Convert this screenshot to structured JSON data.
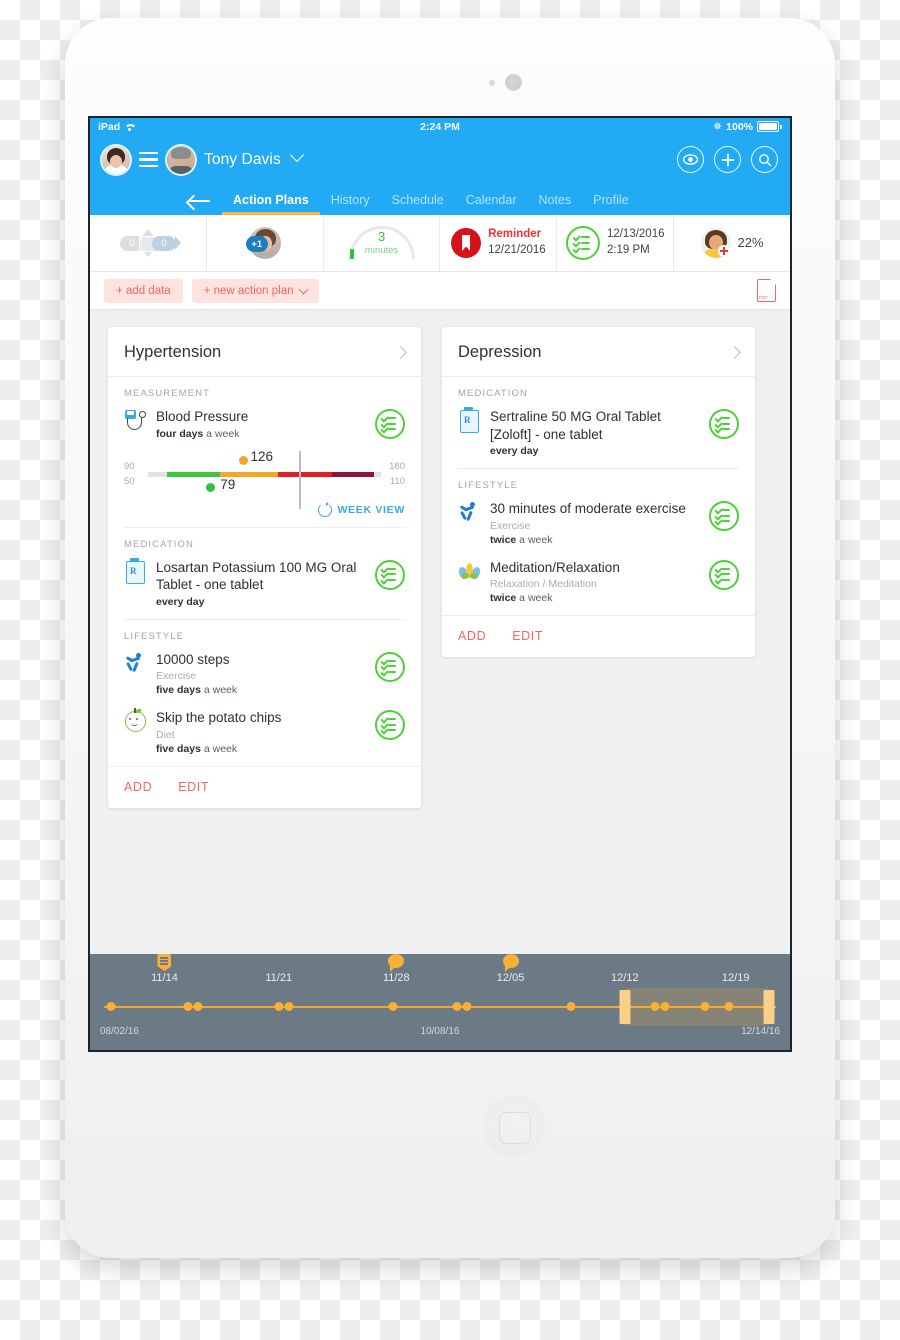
{
  "status_bar": {
    "device": "iPad",
    "wifi_icon": "wifi-icon",
    "time": "2:24 PM",
    "bluetooth_icon": "bluetooth-icon",
    "battery": "100%"
  },
  "topnav": {
    "menu_icon": "hamburger-menu-icon",
    "nurse_avatar": "clinician-avatar",
    "patient_avatar": "patient-avatar",
    "patient_name": "Tony Davis",
    "patient_dropdown_icon": "chevron-down-icon",
    "actions": [
      {
        "name": "eye-icon",
        "label": ""
      },
      {
        "name": "plus-icon",
        "label": ""
      },
      {
        "name": "search-icon",
        "label": ""
      }
    ],
    "back_icon": "back-arrow-icon",
    "tabs": [
      {
        "label": "Action Plans",
        "active": true
      },
      {
        "label": "History",
        "active": false
      },
      {
        "label": "Schedule",
        "active": false
      },
      {
        "label": "Calendar",
        "active": false
      },
      {
        "label": "Notes",
        "active": false
      },
      {
        "label": "Profile",
        "active": false
      }
    ]
  },
  "stats": {
    "messages": {
      "icon": "messages-icon",
      "unread": "0",
      "sent": "0"
    },
    "care_team": {
      "icon": "care-team-avatar",
      "badge": "+1"
    },
    "time_gauge": {
      "icon": "gauge-icon",
      "value": "3",
      "unit": "minutes"
    },
    "reminder": {
      "icon": "bookmark-icon",
      "label": "Reminder",
      "date": "12/21/2016"
    },
    "last_update": {
      "icon": "checklist-icon",
      "date": "12/13/2016",
      "time": "2:19 PM"
    },
    "adherence": {
      "icon": "doctor-avatar",
      "value": "22%"
    }
  },
  "action_row": {
    "add_data": "+ add data",
    "new_action_plan": "+ new action plan",
    "dropdown_icon": "chevron-down-icon",
    "pdf_icon": "pdf-export-icon"
  },
  "cards": [
    {
      "title": "Hypertension",
      "expand_icon": "chevron-right-icon",
      "sections": [
        {
          "label": "MEASUREMENT",
          "items": [
            {
              "icon": "blood-pressure-cuff-icon",
              "title": "Blood Pressure",
              "subtitle": "",
              "freq_bold": "four days",
              "freq_rest": " a week",
              "status_icon": "checklist-green-icon"
            }
          ]
        },
        {
          "label": "MEDICATION",
          "items": [
            {
              "icon": "prescription-bottle-icon",
              "title": "Losartan Potassium 100 MG Oral Tablet - one tablet",
              "subtitle": "",
              "freq_bold": "every day",
              "freq_rest": "",
              "status_icon": "checklist-green-icon"
            }
          ]
        },
        {
          "label": "LIFESTYLE",
          "items": [
            {
              "icon": "running-person-icon",
              "title": "10000 steps",
              "subtitle": "Exercise",
              "freq_bold": "five days",
              "freq_rest": " a week",
              "status_icon": "checklist-green-icon"
            },
            {
              "icon": "apple-diet-icon",
              "title": "Skip the potato chips",
              "subtitle": "Diet",
              "freq_bold": "five days",
              "freq_rest": " a week",
              "status_icon": "checklist-green-icon"
            }
          ]
        }
      ],
      "bp_gauge": {
        "systolic_min": "90",
        "systolic_max": "180",
        "diastolic_min": "50",
        "diastolic_max": "110",
        "systolic_value": "126",
        "diastolic_value": "79",
        "systolic_color": "#f5a623",
        "diastolic_color": "#2ec23f",
        "week_view_label": "WEEK VIEW",
        "week_view_icon": "refresh-icon"
      },
      "footer": {
        "add": "ADD",
        "edit": "EDIT"
      }
    },
    {
      "title": "Depression",
      "expand_icon": "chevron-right-icon",
      "sections": [
        {
          "label": "MEDICATION",
          "items": [
            {
              "icon": "prescription-bottle-icon",
              "title": "Sertraline 50 MG Oral Tablet [Zoloft] - one tablet",
              "subtitle": "",
              "freq_bold": "every day",
              "freq_rest": "",
              "status_icon": "checklist-green-icon"
            }
          ]
        },
        {
          "label": "LIFESTYLE",
          "items": [
            {
              "icon": "running-person-icon",
              "title": "30 minutes of moderate exercise",
              "subtitle": "Exercise",
              "freq_bold": "twice",
              "freq_rest": " a week",
              "status_icon": "checklist-green-icon"
            },
            {
              "icon": "lotus-meditation-icon",
              "title": "Meditation/Relaxation",
              "subtitle": "Relaxation / Meditation",
              "freq_bold": "twice",
              "freq_rest": " a week",
              "status_icon": "checklist-green-icon"
            }
          ]
        }
      ],
      "footer": {
        "add": "ADD",
        "edit": "EDIT"
      }
    }
  ],
  "timeline": {
    "start_label": "08/02/16",
    "mid_label": "10/08/16",
    "end_label": "12/14/16",
    "ticks": [
      {
        "label": "11/14",
        "pct": 9.0,
        "icon": "note-icon"
      },
      {
        "label": "11/21",
        "pct": 26.0,
        "icon": ""
      },
      {
        "label": "11/28",
        "pct": 43.5,
        "icon": "chat-bubble-icon"
      },
      {
        "label": "12/05",
        "pct": 60.5,
        "icon": "chat-bubble-icon"
      },
      {
        "label": "12/12",
        "pct": 77.5,
        "icon": ""
      },
      {
        "label": "12/19",
        "pct": 94.0,
        "icon": ""
      }
    ],
    "points_pct": [
      1.0,
      12.5,
      14.0,
      26.0,
      27.5,
      43.0,
      52.5,
      54.0,
      69.5,
      82.0,
      83.5,
      89.5,
      93.0
    ],
    "selection": {
      "start_pct": 77.5,
      "end_pct": 99.0
    }
  }
}
